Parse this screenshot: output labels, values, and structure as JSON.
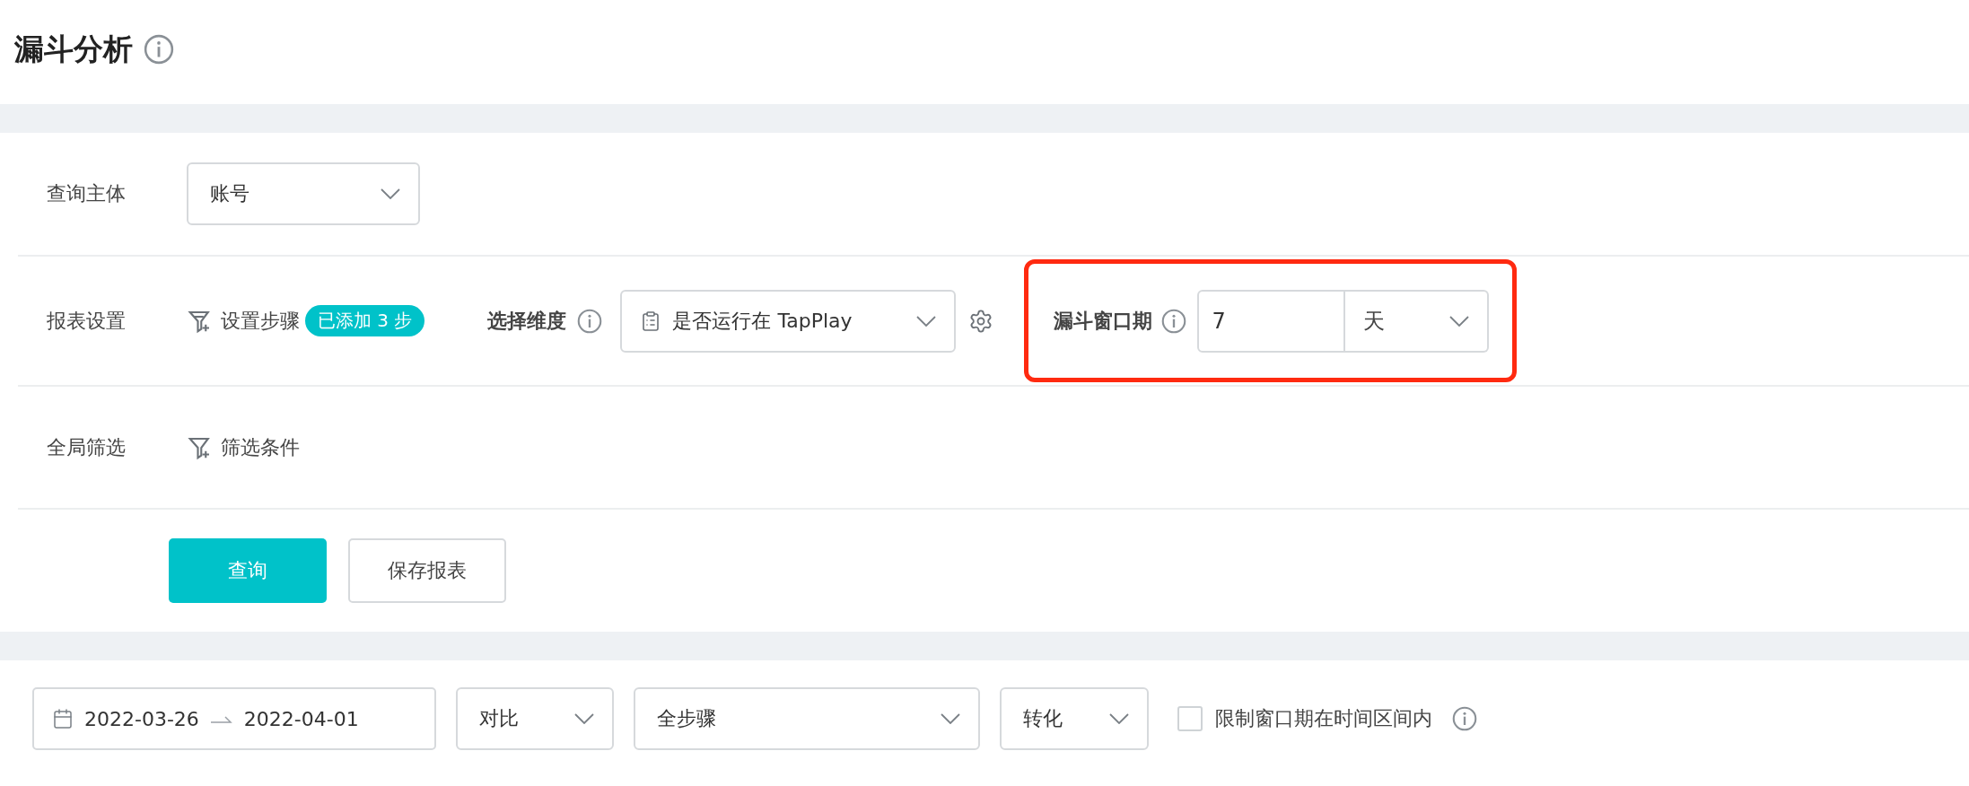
{
  "page": {
    "title": "漏斗分析"
  },
  "query_subject": {
    "label": "查询主体",
    "value": "账号"
  },
  "report_settings": {
    "label": "报表设置",
    "steps_link": "设置步骤",
    "steps_badge": "已添加 3 步",
    "dimension_label": "选择维度",
    "dimension_value": "是否运行在 TapPlay",
    "window_label": "漏斗窗口期",
    "window_value": "7",
    "window_unit": "天",
    "highlighted": true
  },
  "global_filter": {
    "label": "全局筛选",
    "link": "筛选条件"
  },
  "buttons": [
    {
      "label": "查询",
      "kind": "primary"
    },
    {
      "label": "保存报表",
      "kind": "default"
    }
  ],
  "toolbar": {
    "date_start": "2022-03-26",
    "date_end": "2022-04-01",
    "selects": [
      "对比",
      "全步骤",
      "转化"
    ],
    "limit_checkbox": {
      "label": "限制窗口期在时间区间内",
      "checked": false
    }
  }
}
